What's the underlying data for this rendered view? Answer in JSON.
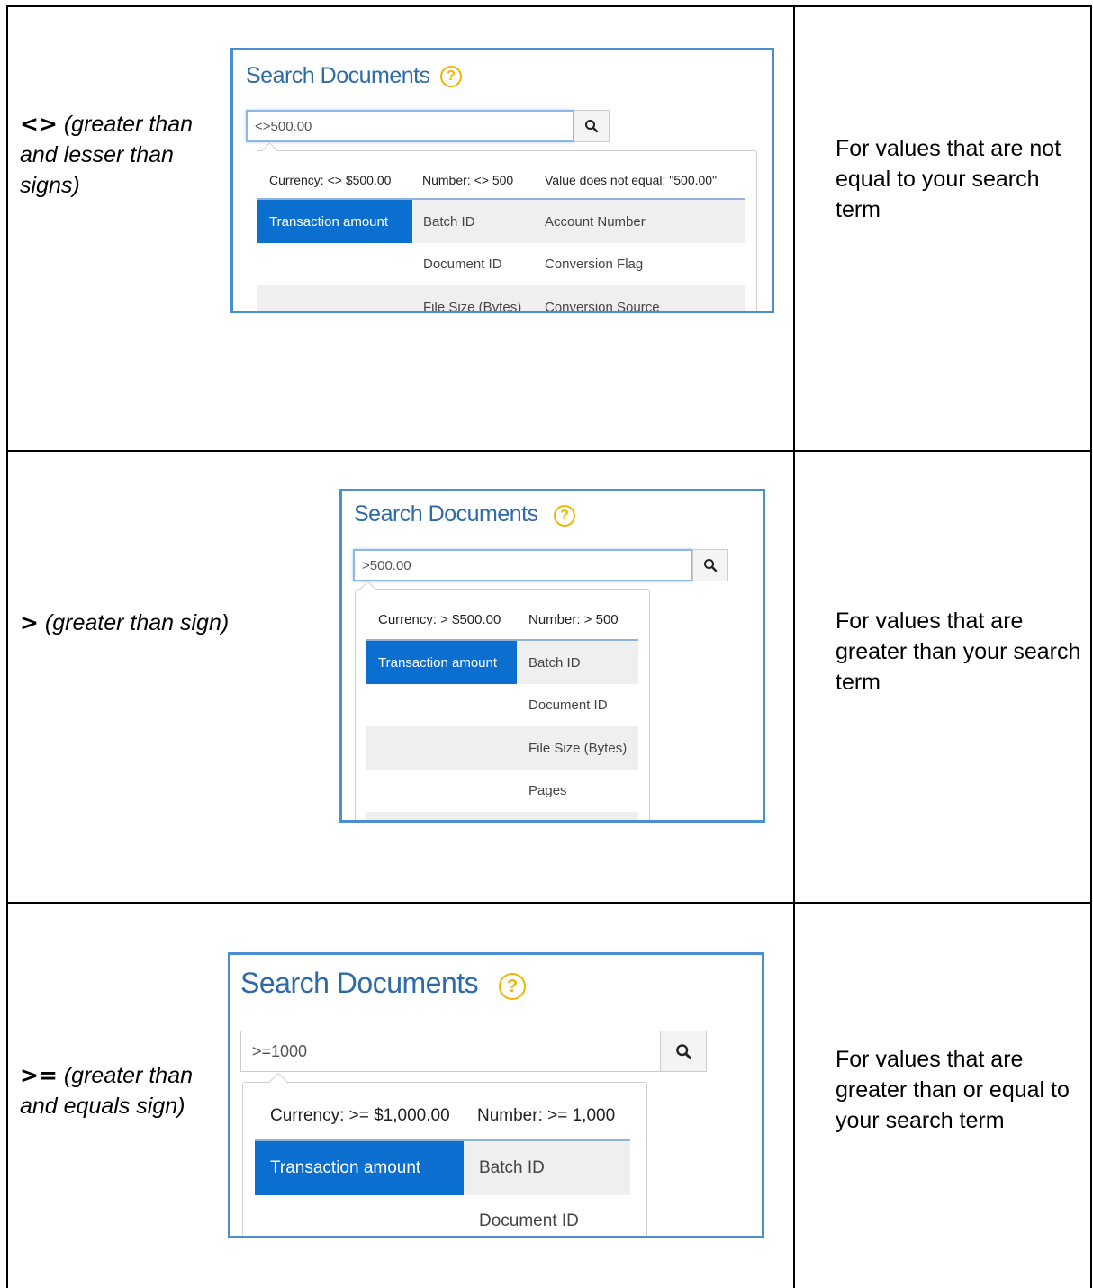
{
  "rows": [
    {
      "operator": "<>",
      "operator_desc": "(greater than and lesser than signs)",
      "explanation": "For values that are not equal to your search term",
      "panel": {
        "title": "Search Documents",
        "help_symbol": "?",
        "input_value": "<>500.00",
        "hints": [
          "Currency: <> $500.00",
          "Number: <> 500",
          "Value does not equal: \"500.00\""
        ],
        "fields": [
          [
            "Transaction amount",
            "Batch ID",
            "Account Number"
          ],
          [
            "",
            "Document ID",
            "Conversion Flag"
          ],
          [
            "",
            "File Size (Bytes)",
            "Conversion Source"
          ]
        ]
      }
    },
    {
      "operator": ">",
      "operator_desc": "(greater than sign)",
      "explanation": "For values that are greater than your search term",
      "panel": {
        "title": "Search Documents",
        "help_symbol": "?",
        "input_value": ">500.00",
        "hints": [
          "Currency: > $500.00",
          "Number: > 500"
        ],
        "fields": [
          [
            "Transaction amount",
            "Batch ID"
          ],
          [
            "",
            "Document ID"
          ],
          [
            "",
            "File Size (Bytes)"
          ],
          [
            "",
            "Pages"
          ]
        ]
      }
    },
    {
      "operator": ">=",
      "operator_desc": "(greater than and equals sign)",
      "explanation": "For values that are greater than or equal to your search term",
      "panel": {
        "title": "Search Documents",
        "help_symbol": "?",
        "input_value": ">=1000",
        "hints": [
          "Currency: >= $1,000.00",
          "Number: >= 1,000"
        ],
        "fields": [
          [
            "Transaction amount",
            "Batch ID"
          ],
          [
            "",
            "Document ID"
          ]
        ]
      }
    }
  ]
}
